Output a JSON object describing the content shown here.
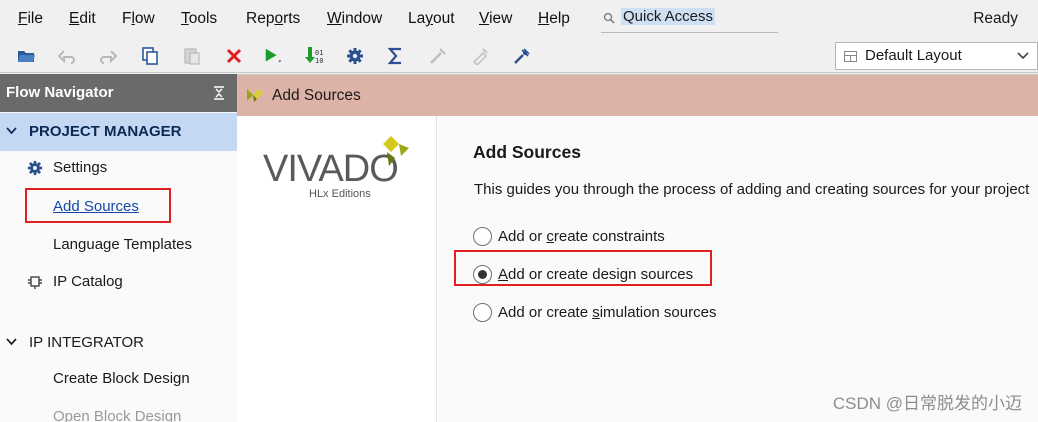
{
  "menu": {
    "file": {
      "pre": "",
      "ul": "F",
      "post": "ile"
    },
    "edit": {
      "pre": "",
      "ul": "E",
      "post": "dit"
    },
    "flow": {
      "pre": "F",
      "ul": "l",
      "post": "ow"
    },
    "tools": {
      "pre": "",
      "ul": "T",
      "post": "ools"
    },
    "reports": {
      "pre": "Rep",
      "ul": "o",
      "post": "rts"
    },
    "window": {
      "pre": "",
      "ul": "W",
      "post": "indow"
    },
    "layout": {
      "pre": "La",
      "ul": "y",
      "post": "out"
    },
    "view": {
      "pre": "",
      "ul": "V",
      "post": "iew"
    },
    "help": {
      "pre": "",
      "ul": "H",
      "post": "elp"
    }
  },
  "quick_access": {
    "text": "Quick Access"
  },
  "status": "Ready",
  "layout_select": {
    "value": "Default Layout"
  },
  "navigator": {
    "title": "Flow Navigator",
    "project_manager": "PROJECT MANAGER",
    "settings": "Settings",
    "add_sources": "Add Sources",
    "language_templates": "Language Templates",
    "ip_catalog": "IP Catalog",
    "ip_integrator": "IP INTEGRATOR",
    "create_block_design": "Create Block Design",
    "open_block_design": "Open Block Design"
  },
  "dialog": {
    "title": "Add Sources",
    "logo_text": "VIVADO",
    "logo_sub": "HLx Editions",
    "heading": "Add Sources",
    "description": "This guides you through the process of adding and creating sources for your project",
    "options": [
      {
        "pre": "Add or ",
        "ul": "c",
        "post": "reate constraints",
        "checked": false
      },
      {
        "pre": "",
        "ul": "A",
        "post": "dd or create design sources",
        "checked": true
      },
      {
        "pre": "Add or create ",
        "ul": "s",
        "post": "imulation sources",
        "checked": false
      }
    ]
  },
  "watermark": "CSDN @日常脱发的小迈",
  "colors": {
    "dialog_title_bg": "#ddb2a7",
    "nav_header_bg": "#6a6a6a",
    "nav_active_bg": "#c4d8f3",
    "highlight_box": "#e02020"
  }
}
